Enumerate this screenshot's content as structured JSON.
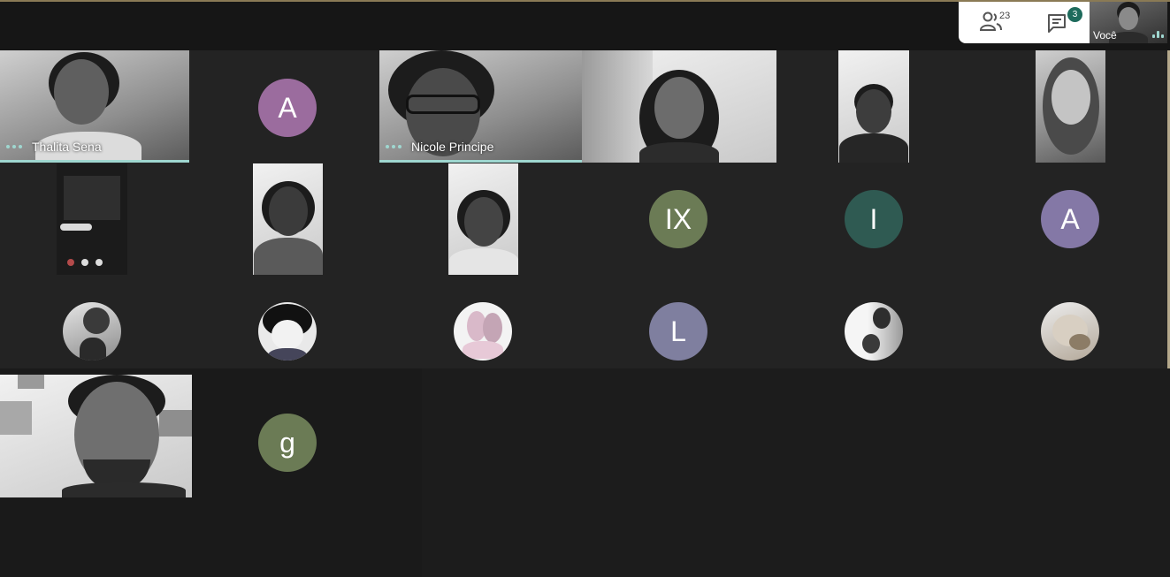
{
  "toolbar": {
    "participants_count": "23",
    "chat_badge": "3",
    "self_label": "Você"
  },
  "tiles": {
    "thalita": "Thalita Sena",
    "nicole": "Nicole Principe"
  },
  "avatars": {
    "a1": "A",
    "ix": "IX",
    "i": "I",
    "a2": "A",
    "l": "L",
    "g": "g"
  },
  "colors": {
    "avatar_purple": "#9b6c9e",
    "avatar_olive": "#6b7b55",
    "avatar_teal": "#2f5a52",
    "avatar_lavender": "#8478a6",
    "avatar_slate": "#7f7f9f",
    "active_speaker": "#9fd7d0",
    "chat_badge": "#1e6b5c"
  }
}
